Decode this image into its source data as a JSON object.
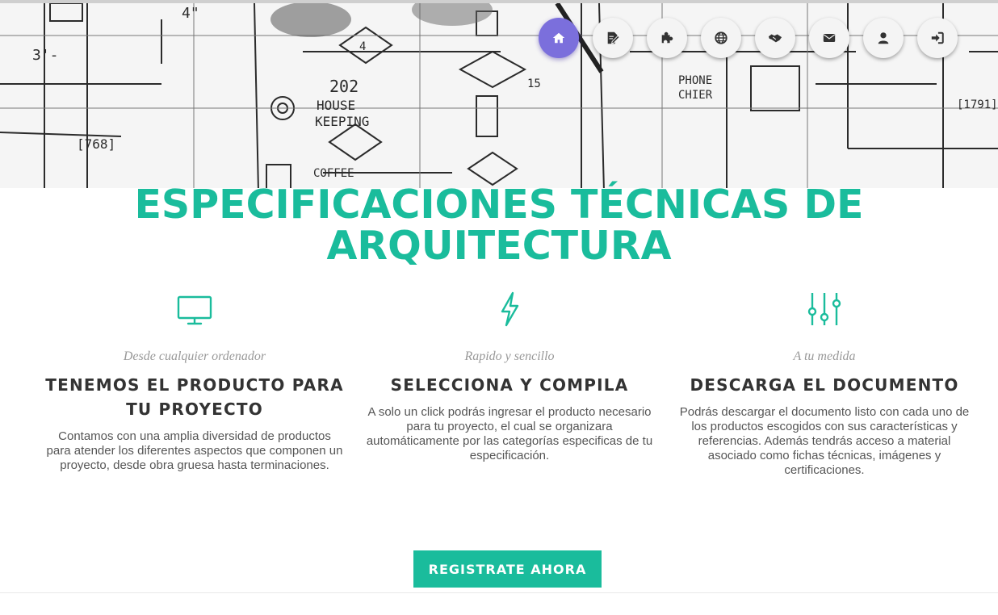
{
  "nav": {
    "items": [
      {
        "icon": "home-icon",
        "active": true
      },
      {
        "icon": "edit-document-icon",
        "active": false
      },
      {
        "icon": "puzzle-icon",
        "active": false
      },
      {
        "icon": "globe-icon",
        "active": false
      },
      {
        "icon": "handshake-icon",
        "active": false
      },
      {
        "icon": "envelope-icon",
        "active": false
      },
      {
        "icon": "user-icon",
        "active": false
      },
      {
        "icon": "sign-in-icon",
        "active": false
      }
    ]
  },
  "page": {
    "title_line1": "ESPECIFICACIONES TÉCNICAS DE",
    "title_line2": "ARQUITECTURA"
  },
  "features": [
    {
      "icon": "monitor-icon",
      "subtitle": "Desde cualquier ordenador",
      "heading_line1": "TENEMOS EL PRODUCTO PARA",
      "heading_line2": "TU PROYECTO",
      "description": "Contamos con una amplia diversidad de productos para atender los diferentes aspectos que componen un proyecto, desde obra gruesa hasta terminaciones."
    },
    {
      "icon": "lightning-icon",
      "subtitle": "Rapido y sencillo",
      "heading_line1": "SELECCIONA Y COMPILA",
      "heading_line2": "",
      "description": "A solo un click podrás ingresar el producto necesario para tu proyecto, el cual se organizara automáticamente por las categorías especificas de tu especificación."
    },
    {
      "icon": "sliders-icon",
      "subtitle": "A tu medida",
      "heading_line1": "DESCARGA EL DOCUMENTO",
      "heading_line2": "",
      "description": "Podrás descargar el documento listo con cada uno de los productos escogidos con sus características y referencias. Además tendrás acceso a material asociado como fichas técnicas, imágenes y certificaciones."
    }
  ],
  "cta": {
    "label": "REGISTRATE AHORA"
  },
  "colors": {
    "accent": "#1abc9c",
    "nav_active": "#7b6fdc"
  }
}
